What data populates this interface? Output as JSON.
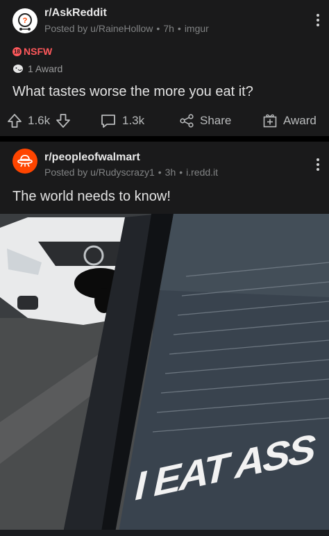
{
  "post1": {
    "subreddit": "r/AskReddit",
    "posted_by": "Posted by u/RaineHollow",
    "age": "7h",
    "source": "imgur",
    "nsfw_label": "NSFW",
    "nsfw_badge": "18",
    "award_label": "1 Award",
    "title": "What tastes worse the more you eat it?",
    "upvotes": "1.6k",
    "comments": "1.3k",
    "share_label": "Share",
    "award_button_label": "Award"
  },
  "post2": {
    "subreddit": "r/peopleofwalmart",
    "posted_by": "Posted by u/Rudyscrazy1",
    "age": "3h",
    "source": "i.redd.it",
    "title": "The world needs to know!",
    "image_text": "I EAT ASS"
  },
  "colors": {
    "card_bg": "#1a1a1b",
    "nsfw_red": "#ff585b",
    "subreddit_orange": "#ff4500"
  },
  "icons": [
    "askreddit-avatar-icon",
    "nsfw-badge-icon",
    "award-emoji-icon",
    "upvote-arrow-icon",
    "downvote-arrow-icon",
    "comment-bubble-icon",
    "share-icon",
    "award-gift-icon",
    "peopleofwalmart-ufo-icon",
    "more-options-icon"
  ]
}
